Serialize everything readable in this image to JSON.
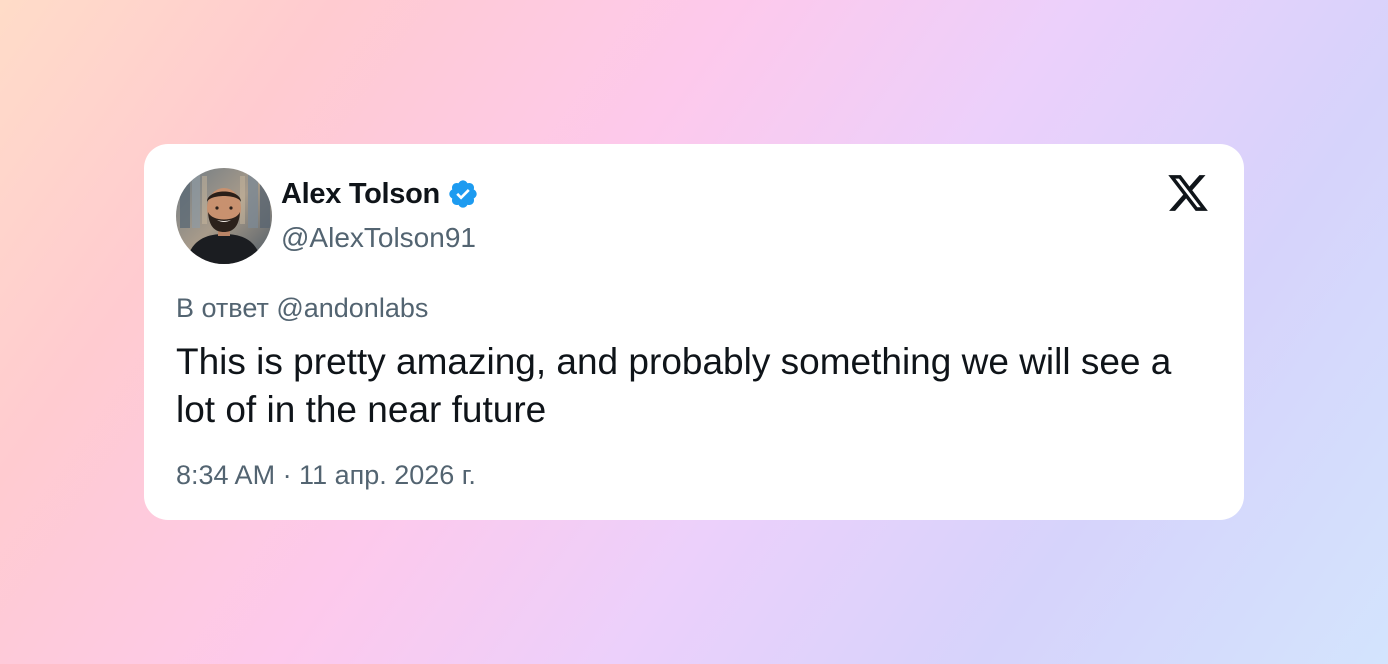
{
  "tweet": {
    "author": {
      "display_name": "Alex Tolson",
      "handle": "@AlexTolson91",
      "verified": true,
      "verified_icon": "verified-badge-icon",
      "avatar": "profile-photo"
    },
    "platform_icon": "x-logo-icon",
    "reply_to": "В ответ @andonlabs",
    "text": "This is pretty amazing, and probably something we will see a lot of in the near future",
    "timestamp": "8:34 AM · 11 апр. 2026 г."
  },
  "colors": {
    "verified_blue": "#1d9bf0",
    "text_primary": "#0f1419",
    "text_secondary": "#536471",
    "card_background": "#ffffff"
  }
}
